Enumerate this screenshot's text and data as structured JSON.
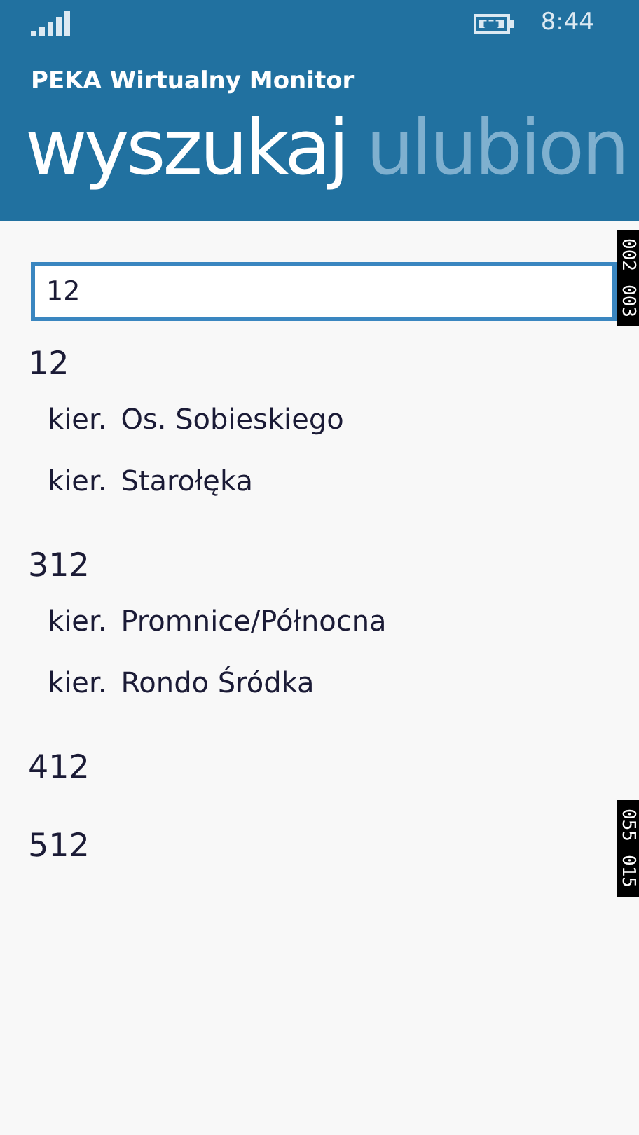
{
  "status_bar": {
    "time": "8:44"
  },
  "app_title": "PEKA Wirtualny Monitor",
  "pivot": [
    {
      "label": "wyszukaj",
      "selected": true
    },
    {
      "label": "ulubion",
      "selected": false
    }
  ],
  "search": {
    "value": "12"
  },
  "results": [
    {
      "line": "12",
      "directions": [
        {
          "prefix": "kier.",
          "name": "Os. Sobieskiego"
        },
        {
          "prefix": "kier.",
          "name": "Starołęka"
        }
      ]
    },
    {
      "line": "312",
      "directions": [
        {
          "prefix": "kier.",
          "name": "Promnice/Północna"
        },
        {
          "prefix": "kier.",
          "name": "Rondo Śródka"
        }
      ]
    },
    {
      "line": "412"
    },
    {
      "line": "512"
    }
  ],
  "frame_counters": [
    [
      "002",
      "003"
    ],
    [
      "055",
      "015"
    ]
  ]
}
